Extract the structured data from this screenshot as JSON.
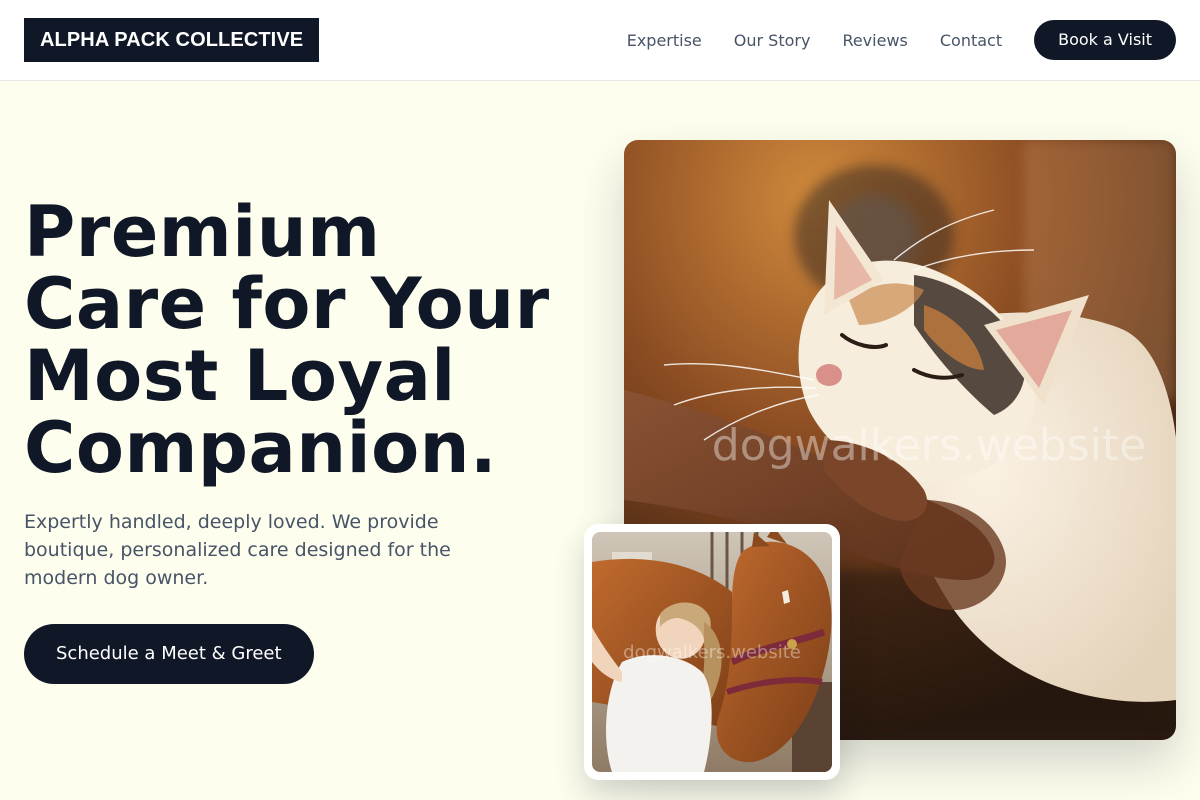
{
  "header": {
    "logo_text": "ALPHA PACK COLLECTIVE",
    "nav": [
      {
        "label": "Expertise"
      },
      {
        "label": "Our Story"
      },
      {
        "label": "Reviews"
      },
      {
        "label": "Contact"
      }
    ],
    "cta_label": "Book a Visit"
  },
  "hero": {
    "title_lines": [
      "Premium",
      "Care for Your",
      "Most Loyal",
      "Companion."
    ],
    "subtitle": "Expertly handled, deeply loved. We provide boutique, personalized care designed for the modern dog owner.",
    "cta_label": "Schedule a Meet & Greet"
  },
  "images": {
    "main_watermark": "dogwalkers.website",
    "secondary_watermark": "dogwalkers.website"
  },
  "colors": {
    "brand_dark": "#101828",
    "page_background": "#fefeee",
    "muted_text": "#475467"
  }
}
